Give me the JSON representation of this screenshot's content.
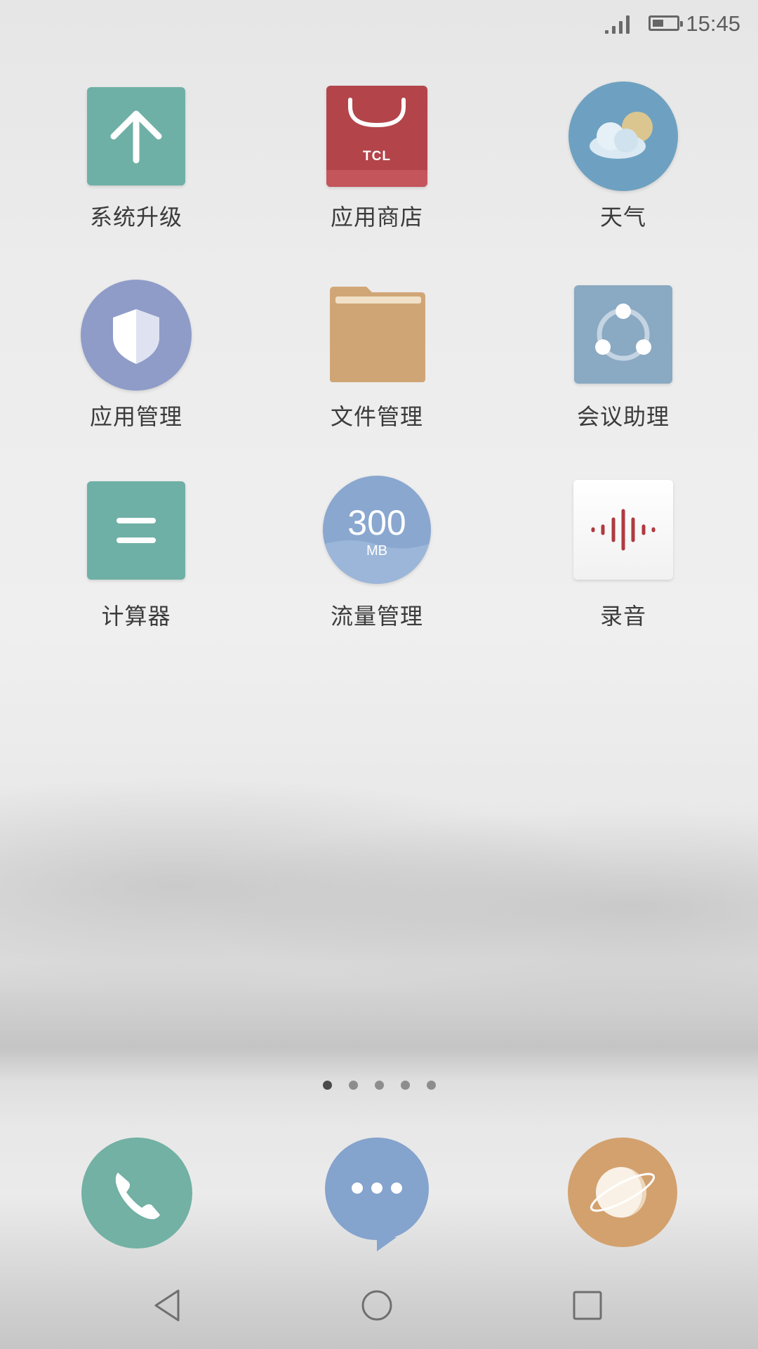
{
  "status_bar": {
    "time": "15:45",
    "signal_icon": "signal-icon",
    "battery_icon": "battery-icon",
    "battery_level": 0.5
  },
  "apps": [
    {
      "label": "系统升级",
      "icon": "upgrade-arrow-icon",
      "color": "#6fb0a6"
    },
    {
      "label": "应用商店",
      "icon": "tcl-store-bag-icon",
      "color": "#b3454a",
      "badge_text": "TCL"
    },
    {
      "label": "天气",
      "icon": "weather-cloud-sun-icon",
      "color": "#6ea1c1"
    },
    {
      "label": "应用管理",
      "icon": "shield-icon",
      "color": "#8f9cc8"
    },
    {
      "label": "文件管理",
      "icon": "folder-icon",
      "color": "#d1a677"
    },
    {
      "label": "会议助理",
      "icon": "meeting-share-icon",
      "color": "#8aa9c2"
    },
    {
      "label": "计算器",
      "icon": "equals-icon",
      "color": "#6fb0a6"
    },
    {
      "label": "流量管理",
      "icon": "data-usage-icon",
      "color": "#89a7cf",
      "value": "300",
      "unit": "MB"
    },
    {
      "label": "录音",
      "icon": "sound-wave-icon",
      "color": "#ffffff"
    }
  ],
  "page_indicator": {
    "total": 5,
    "active": 1
  },
  "dock": [
    {
      "icon": "phone-icon",
      "color": "#72b1a4"
    },
    {
      "icon": "messages-bubble-icon",
      "color": "#84a3cd"
    },
    {
      "icon": "browser-planet-icon",
      "color": "#d3a16e"
    }
  ],
  "nav_bar": {
    "back_icon": "back-triangle-icon",
    "home_icon": "home-circle-icon",
    "recents_icon": "recents-square-icon"
  }
}
